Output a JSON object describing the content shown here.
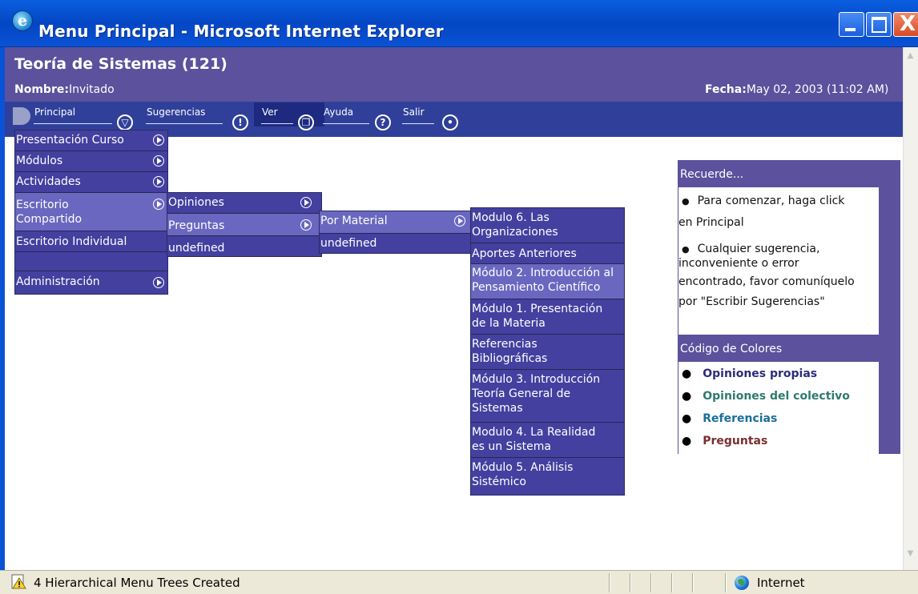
{
  "window": {
    "title": "Menu Principal - Microsoft Internet Explorer",
    "close_glyph": "X"
  },
  "header": {
    "course_title": "Teoría de Sistemas (121)",
    "nombre_label": "Nombre:",
    "nombre_value": "Invitado",
    "fecha_label": "Fecha:",
    "fecha_value": "May 02, 2003 (11:02 AM)"
  },
  "nav": {
    "items": [
      {
        "label": "Principal",
        "icon": "chevron-down-circle-icon",
        "glyph": "▽"
      },
      {
        "label": "Sugerencias",
        "icon": "exclamation-circle-icon",
        "glyph": "!"
      },
      {
        "label": "Ver",
        "icon": "window-circle-icon",
        "glyph": "❐"
      },
      {
        "label": "Ayuda",
        "icon": "question-circle-icon",
        "glyph": "?"
      },
      {
        "label": "Salir",
        "icon": "dot-circle-icon",
        "glyph": "•"
      }
    ]
  },
  "menu1": {
    "items": [
      {
        "label": "Presentación Curso"
      },
      {
        "label": "Módulos"
      },
      {
        "label": "Actividades"
      },
      {
        "label_line1": "Escritorio",
        "label_line2": "Compartido"
      },
      {
        "label": "Escritorio Individual"
      },
      {
        "label": ""
      },
      {
        "label": "Administración"
      }
    ]
  },
  "menu2": {
    "items": [
      {
        "label": "Opiniones"
      },
      {
        "label": "Preguntas"
      },
      {
        "label": "undefined"
      }
    ]
  },
  "menu3": {
    "items": [
      {
        "label": "Por Material"
      },
      {
        "label": "undefined"
      }
    ]
  },
  "menu4": {
    "items": [
      {
        "line1": "Modulo 6. Las",
        "line2": "Organizaciones"
      },
      {
        "line1": "Aportes Anteriores"
      },
      {
        "line1": "Módulo 2. Introducción al",
        "line2": "Pensamiento Científico"
      },
      {
        "line1": "Módulo 1. Presentación",
        "line2": "de la Materia"
      },
      {
        "line1": "Referencias",
        "line2": "Bibliográficas"
      },
      {
        "line1": "Módulo 3. Introducción",
        "line2": "Teoría General de",
        "line3": "Sistemas"
      },
      {
        "line1": "Modulo 4. La Realidad",
        "line2": "es un Sistema"
      },
      {
        "line1": "Módulo 5. Análisis",
        "line2": "Sistémico"
      }
    ]
  },
  "side": {
    "recuerde_title": "Recuerde...",
    "tip1_line1": "Para comenzar, haga click",
    "tip1_line2": "en Principal",
    "tip2_line1": "Cualquier sugerencia,",
    "tip2_line2": "inconveniente o error",
    "tip2_line3": "encontrado, favor comuníquelo",
    "tip2_line4": "por \"Escribir Sugerencias\"",
    "bullet": "●",
    "codigo_title": "Código de Colores",
    "legend": [
      {
        "label": "Opiniones propias",
        "color": "#2c2c7a"
      },
      {
        "label": "Opiniones del colectivo",
        "color": "#2e7a6e"
      },
      {
        "label": "Referencias",
        "color": "#1a6e9a"
      },
      {
        "label": "Preguntas",
        "color": "#7a2e2e"
      }
    ]
  },
  "status": {
    "text": "4 Hierarchical Menu Trees Created",
    "zone": "Internet"
  },
  "colors": {
    "title_bar": "#0a52d6",
    "header": "#5b519c",
    "nav": "#30409a",
    "menu": "#4340a0"
  }
}
